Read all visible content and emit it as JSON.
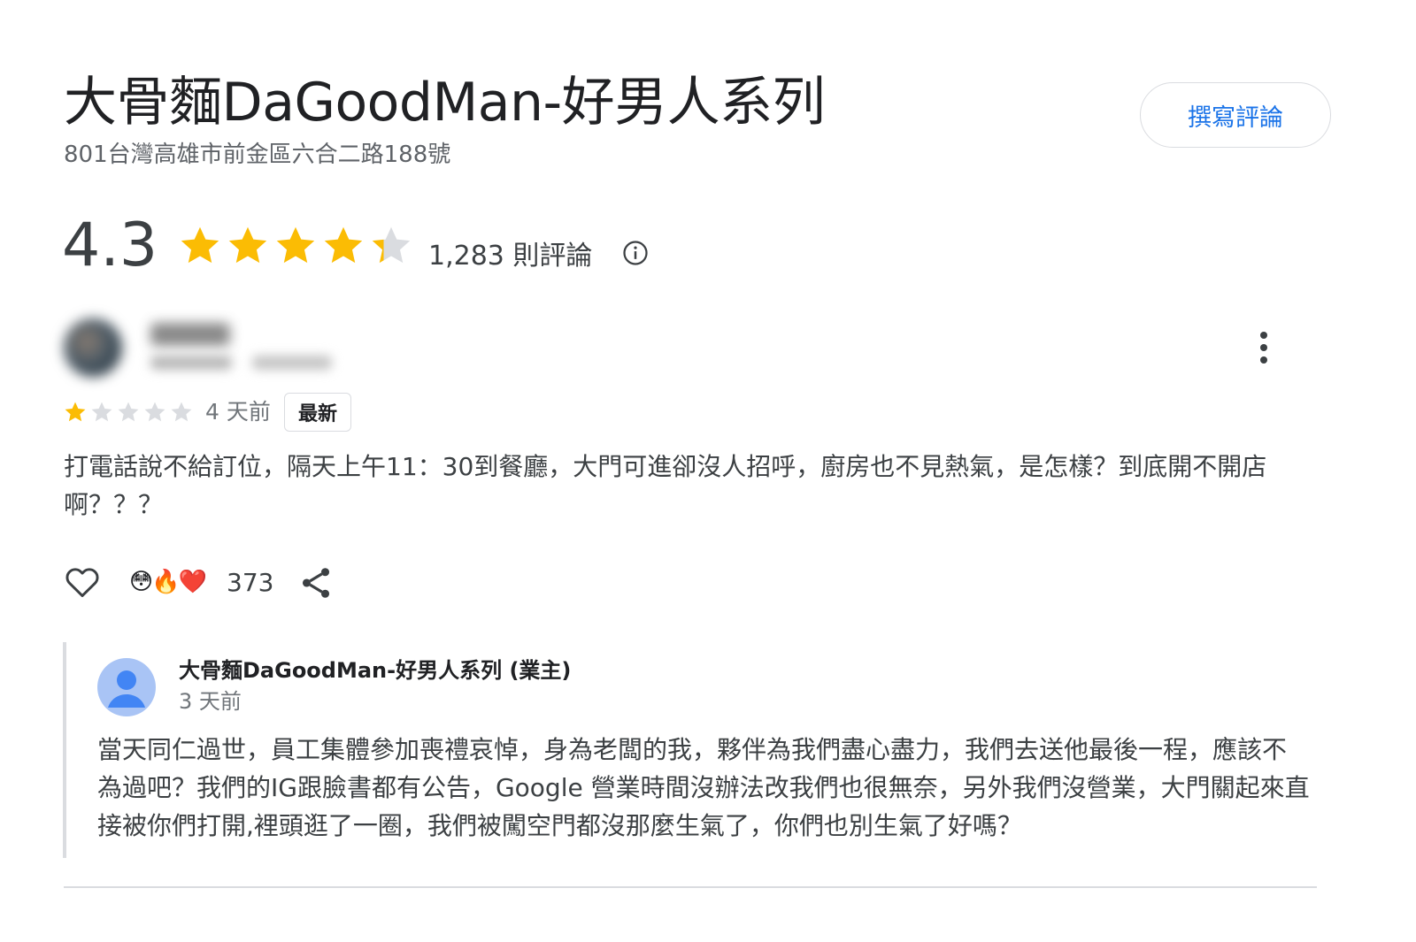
{
  "place": {
    "title": "大骨麵DaGoodMan-好男人系列",
    "address": "801台灣高雄市前金區六合二路188號",
    "write_review_label": "撰寫評論",
    "rating": "4.3",
    "rating_value": 4.3,
    "review_count": "1,283 則評論"
  },
  "review": {
    "star_rating": 1,
    "date": "4 天前",
    "badge": "最新",
    "text": "打電話說不給訂位，隔天上午11：30到餐廳，大門可進卻沒人招呼，廚房也不見熱氣，是怎樣？到底開不開店啊？？？",
    "reactions": [
      "😳",
      "🔥",
      "❤️"
    ],
    "reaction_count": "373"
  },
  "owner_reply": {
    "name": "大骨麵DaGoodMan-好男人系列 (業主)",
    "date": "3 天前",
    "text": "當天同仁過世，員工集體參加喪禮哀悼，身為老闆的我，夥伴為我們盡心盡力，我們去送他最後一程，應該不為過吧？我們的IG跟臉書都有公告，Google 營業時間沒辦法改我們也很無奈，另外我們沒營業，大門關起來直接被你們打開,裡頭逛了一圈，我們被闖空門都沒那麼生氣了，你們也別生氣了好嗎？"
  },
  "colors": {
    "star": "#fbbc04",
    "star_empty": "#dadce0",
    "link": "#1a73e8",
    "text": "#3c4043",
    "muted": "#70757a"
  },
  "icons": [
    "star-icon",
    "info-icon",
    "more-vert-icon",
    "heart-outline-icon",
    "share-icon",
    "person-icon"
  ]
}
